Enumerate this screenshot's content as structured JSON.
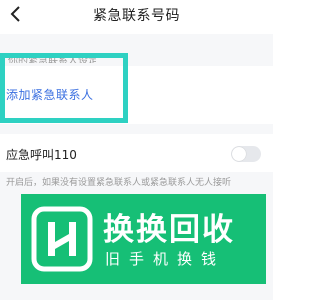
{
  "header": {
    "title": "紧急联系号码",
    "back_icon": "chevron-left-icon"
  },
  "contacts": {
    "faded_hint": "你的紧急联系人设定",
    "add_contact_label": "添加紧急联系人",
    "highlight_color": "#2ed1c2"
  },
  "emergency_call": {
    "label": "应急呼叫110",
    "toggle_on": false
  },
  "description": "开启后，如果没有设置紧急联系人或紧急联系人无人接听",
  "watermark": {
    "brand": "换换回收",
    "subtitle": "旧手机换钱",
    "color": "#16bf76"
  },
  "colors": {
    "link": "#3a6fe0",
    "background": "#f6f7f9"
  }
}
